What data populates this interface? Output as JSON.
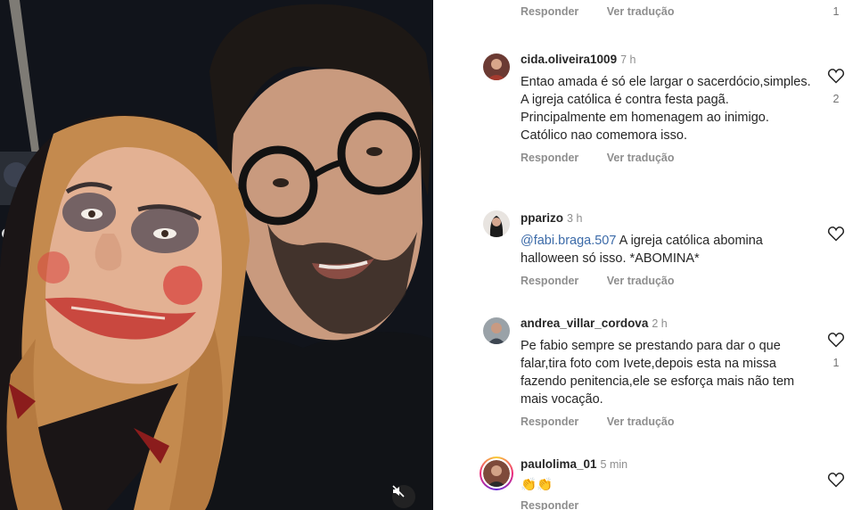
{
  "top_row": {
    "reply_label": "Responder",
    "translate_label": "Ver tradução",
    "like_count": "1"
  },
  "comments": [
    {
      "username": "cida.oliveira1009",
      "time": "7 h",
      "text": "Entao amada é só ele largar o sacerdócio,simples. A igreja católica é contra festa pagã. Principalmente em homenagem ao inimigo. Católico nao comemora isso.",
      "reply_label": "Responder",
      "translate_label": "Ver tradução",
      "like_count": "2",
      "avatar_icon": "user-avatar"
    },
    {
      "username": "pparizo",
      "time": "3 h",
      "mention": "@fabi.braga.507",
      "text": " A igreja católica abomina halloween só isso. *ABOMINA*",
      "reply_label": "Responder",
      "translate_label": "Ver tradução",
      "like_count": "",
      "avatar_icon": "user-avatar"
    },
    {
      "username": "andrea_villar_cordova",
      "time": "2 h",
      "text": "Pe fabio sempre se prestando para dar o que falar,tira foto com Ivete,depois esta na missa fazendo penitencia,ele se esforça mais não tem mais vocação.",
      "reply_label": "Responder",
      "translate_label": "Ver tradução",
      "like_count": "1",
      "avatar_icon": "user-avatar"
    },
    {
      "username": "paulolima_01",
      "time": "5 min",
      "text": "👏👏",
      "reply_label": "Responder",
      "like_count": "",
      "avatar_icon": "user-avatar-story-ring"
    }
  ],
  "photo": {
    "mute_icon": "muted-speaker-icon"
  },
  "colors": {
    "mention": "#3b6aa8",
    "muted_text": "#8e8e8e"
  }
}
